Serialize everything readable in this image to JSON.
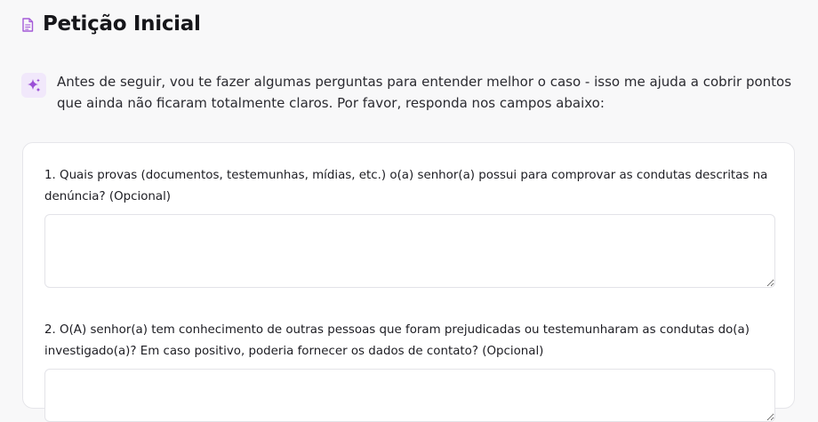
{
  "header": {
    "title": "Petição Inicial",
    "icon": "document-icon",
    "icon_color": "#a45ad8"
  },
  "intro": {
    "icon": "sparkle-icon",
    "text": "Antes de seguir, vou te fazer algumas perguntas para entender melhor o caso - isso me ajuda a cobrir pontos que ainda não ficaram totalmente claros. Por favor, responda nos campos abaixo:"
  },
  "questions": [
    {
      "label": "1. Quais provas (documentos, testemunhas, mídias, etc.) o(a) senhor(a) possui para comprovar as condutas descritas na denúncia? (Opcional)",
      "value": ""
    },
    {
      "label": "2. O(A) senhor(a) tem conhecimento de outras pessoas que foram prejudicadas ou testemunharam as condutas do(a) investigado(a)? Em caso positivo, poderia fornecer os dados de contato? (Opcional)",
      "value": ""
    }
  ],
  "colors": {
    "accent": "#9b4fd6",
    "accent_bg": "#f1e8fb",
    "page_bg": "#f8f8f9",
    "card_border": "#e6e6ea"
  }
}
